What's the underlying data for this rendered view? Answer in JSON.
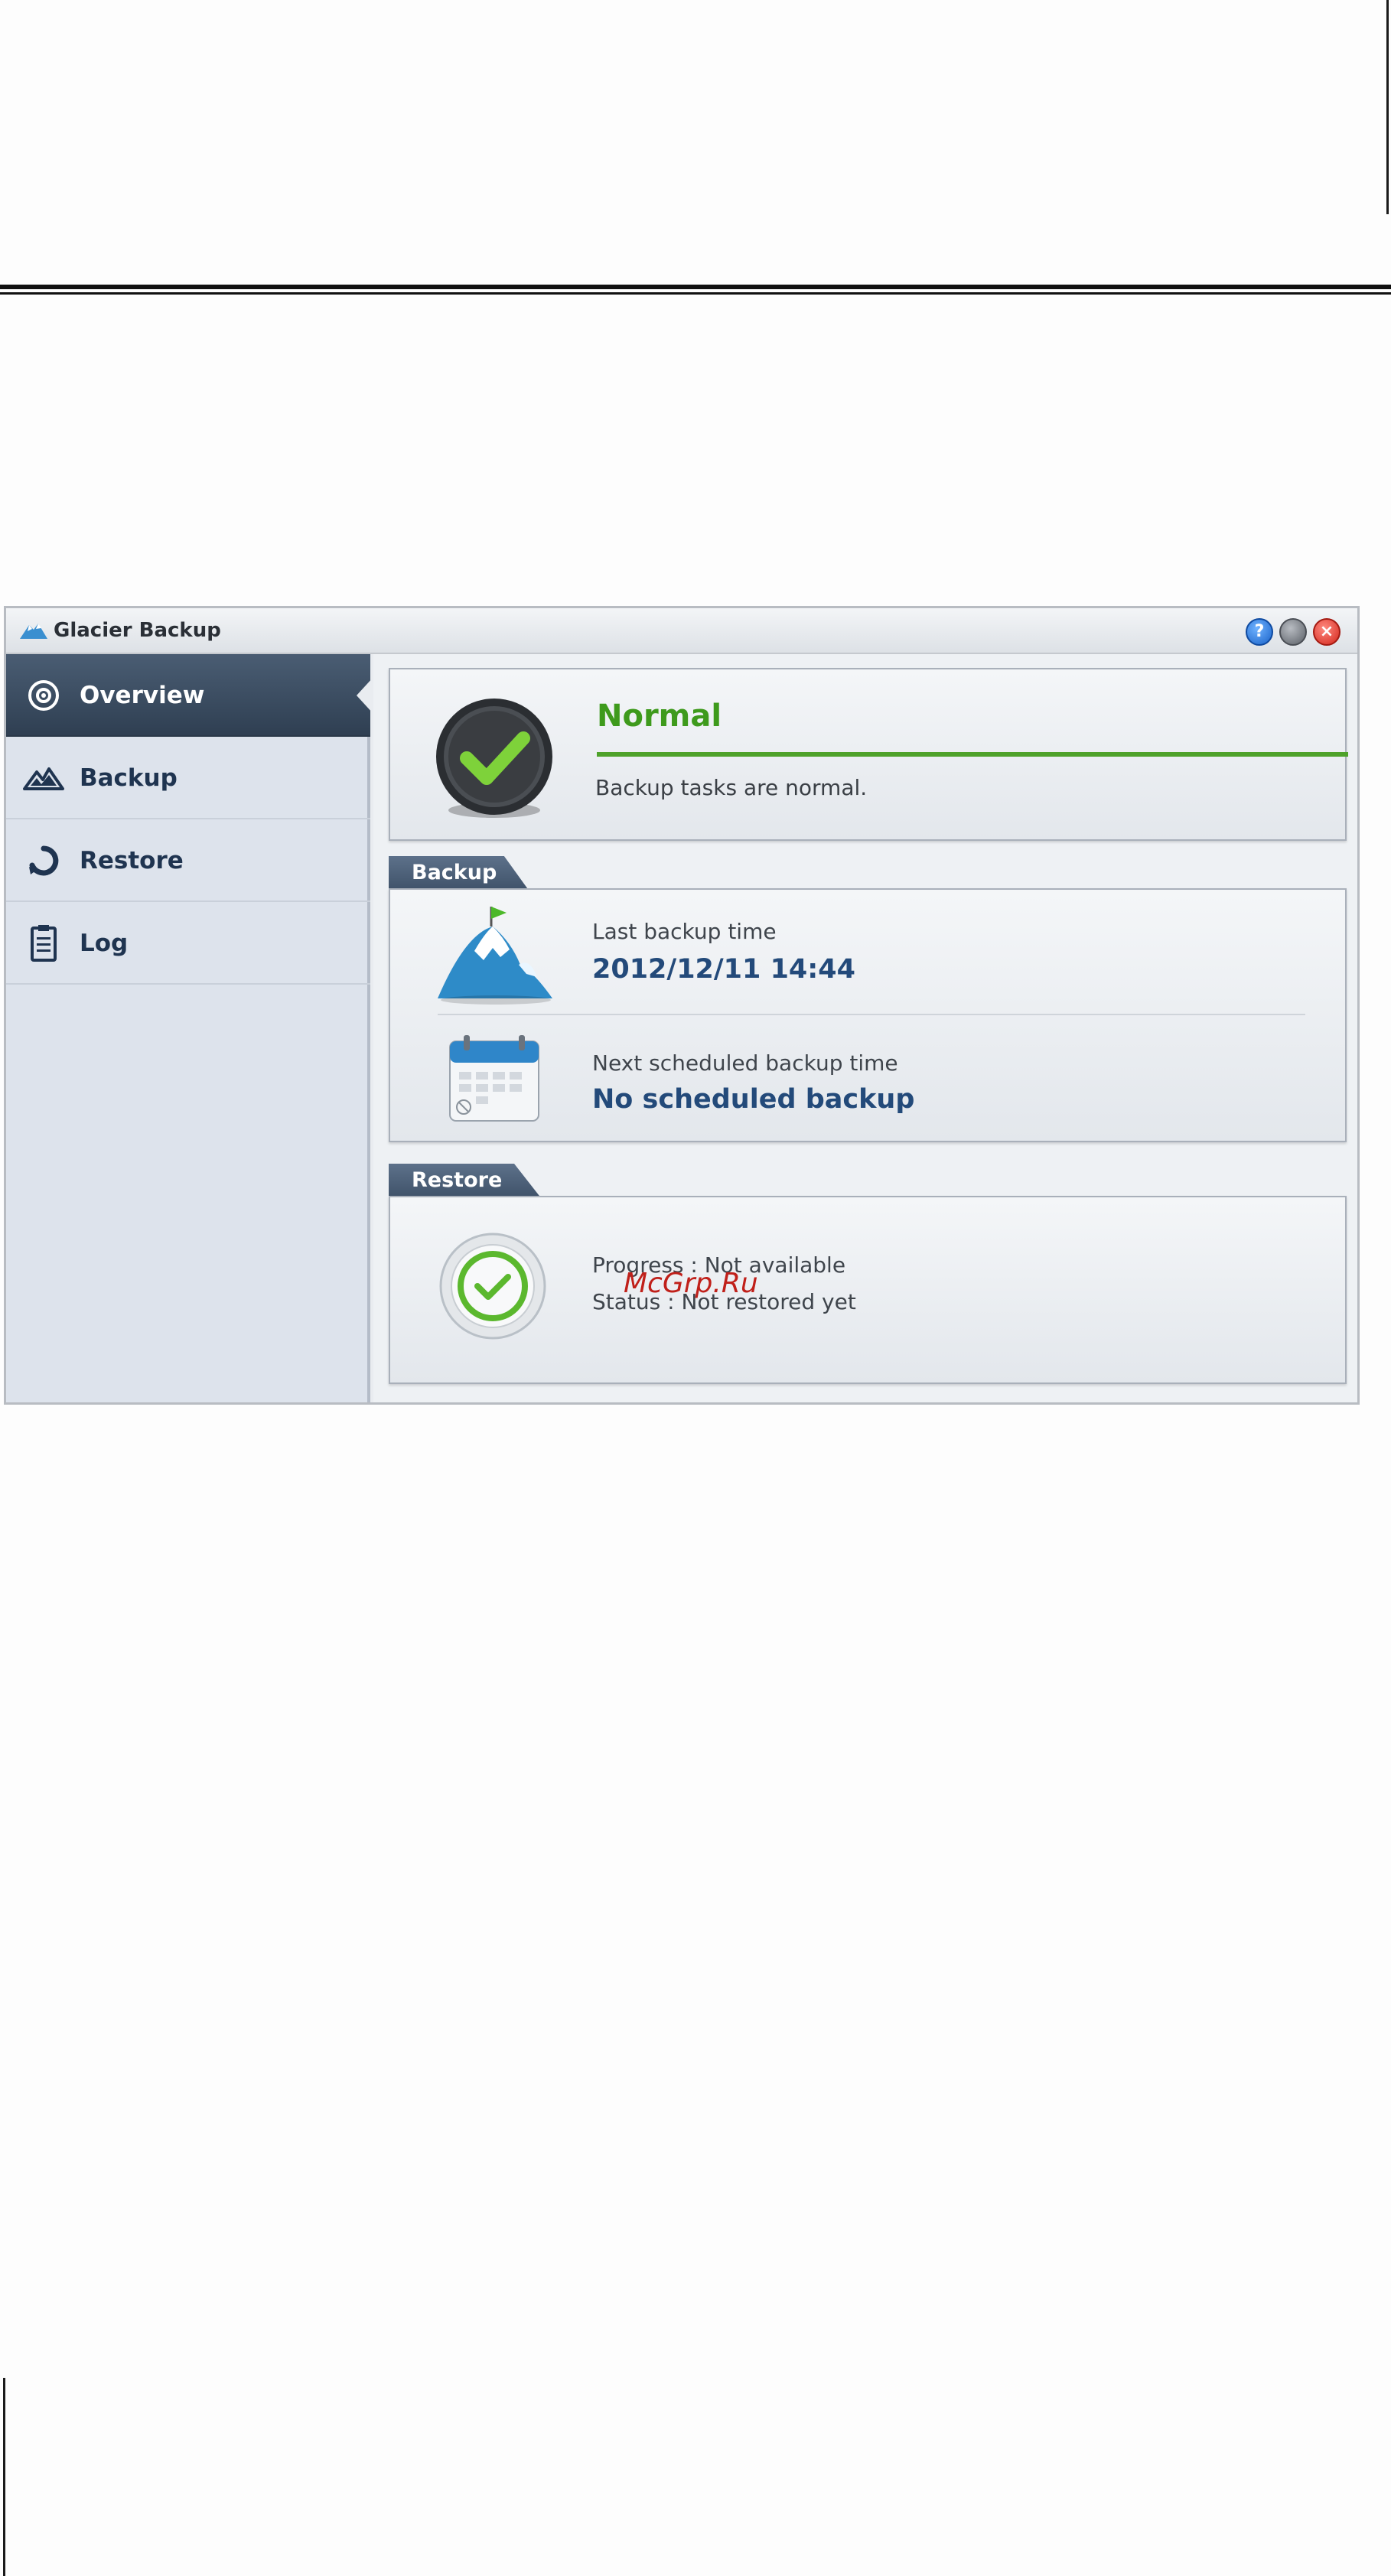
{
  "window": {
    "title": "Glacier Backup",
    "controls": {
      "help": "?",
      "minimize": "",
      "close": "×"
    }
  },
  "sidebar": {
    "items": [
      {
        "label": "Overview",
        "icon": "eye-icon",
        "active": true
      },
      {
        "label": "Backup",
        "icon": "mountain-icon",
        "active": false
      },
      {
        "label": "Restore",
        "icon": "restore-icon",
        "active": false
      },
      {
        "label": "Log",
        "icon": "clipboard-icon",
        "active": false
      }
    ]
  },
  "status": {
    "title": "Normal",
    "description": "Backup tasks are normal.",
    "color": "#3e9a1c"
  },
  "backup": {
    "tab": "Backup",
    "last_label": "Last backup time",
    "last_value": "2012/12/11 14:44",
    "next_label": "Next scheduled backup time",
    "next_value": "No scheduled backup"
  },
  "restore": {
    "tab": "Restore",
    "progress": "Progress : Not available",
    "status": "Status : Not restored yet"
  },
  "watermark": "McGrp.Ru"
}
